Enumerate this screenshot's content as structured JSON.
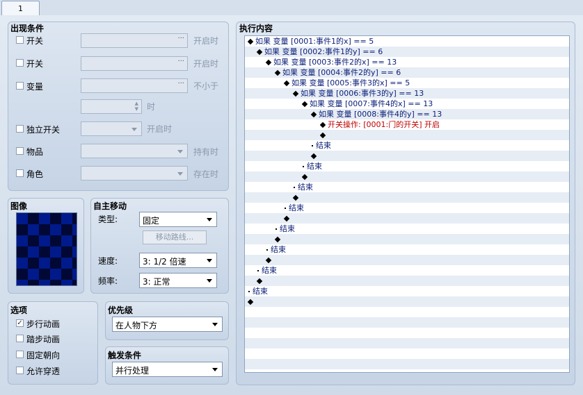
{
  "tab": {
    "label": "1"
  },
  "conditions": {
    "title": "出现条件",
    "rows": [
      {
        "label": "开关",
        "hint": "开启时"
      },
      {
        "label": "开关",
        "hint": "开启时"
      },
      {
        "label": "变量",
        "hint": "不小于"
      },
      {
        "label": "",
        "hint": "时"
      },
      {
        "label": "独立开关",
        "hint": "开启时"
      },
      {
        "label": "物品",
        "hint": "持有时"
      },
      {
        "label": "角色",
        "hint": "存在时"
      }
    ]
  },
  "image": {
    "title": "图像"
  },
  "movement": {
    "title": "自主移动",
    "type_label": "类型:",
    "type_value": "固定",
    "route_button": "移动路线...",
    "speed_label": "速度:",
    "speed_value": "3: 1/2 倍速",
    "freq_label": "频率:",
    "freq_value": "3: 正常"
  },
  "options": {
    "title": "选项",
    "items": [
      {
        "label": "步行动画",
        "checked": true
      },
      {
        "label": "踏步动画",
        "checked": false
      },
      {
        "label": "固定朝向",
        "checked": false
      },
      {
        "label": "允许穿透",
        "checked": false
      }
    ]
  },
  "priority": {
    "title": "优先级",
    "value": "在人物下方"
  },
  "trigger": {
    "title": "触发条件",
    "value": "并行处理"
  },
  "commands": {
    "title": "执行内容",
    "lines": [
      {
        "indent": 0,
        "marker": "diamond",
        "text": "如果 变量 [0001:事件1的x] == 5",
        "color": "normal"
      },
      {
        "indent": 1,
        "marker": "diamond",
        "text": "如果 变量 [0002:事件1的y] == 6",
        "color": "normal"
      },
      {
        "indent": 2,
        "marker": "diamond",
        "text": "如果 变量 [0003:事件2的x] == 13",
        "color": "normal"
      },
      {
        "indent": 3,
        "marker": "diamond",
        "text": "如果 变量 [0004:事件2的y] == 6",
        "color": "normal"
      },
      {
        "indent": 4,
        "marker": "diamond",
        "text": "如果 变量 [0005:事件3的x] == 5",
        "color": "normal"
      },
      {
        "indent": 5,
        "marker": "diamond",
        "text": "如果 变量 [0006:事件3的y] == 13",
        "color": "normal"
      },
      {
        "indent": 6,
        "marker": "diamond",
        "text": "如果 变量 [0007:事件4的x] == 13",
        "color": "normal"
      },
      {
        "indent": 7,
        "marker": "diamond",
        "text": "如果 变量 [0008:事件4的y] == 13",
        "color": "normal"
      },
      {
        "indent": 8,
        "marker": "diamond",
        "text": "开关操作: [0001:门的开关] 开启",
        "color": "red"
      },
      {
        "indent": 8,
        "marker": "diamond",
        "text": "",
        "color": "normal"
      },
      {
        "indent": 7,
        "marker": "dot",
        "text": "结束",
        "color": "normal"
      },
      {
        "indent": 7,
        "marker": "diamond",
        "text": "",
        "color": "normal"
      },
      {
        "indent": 6,
        "marker": "dot",
        "text": "结束",
        "color": "normal"
      },
      {
        "indent": 6,
        "marker": "diamond",
        "text": "",
        "color": "normal"
      },
      {
        "indent": 5,
        "marker": "dot",
        "text": "结束",
        "color": "normal"
      },
      {
        "indent": 5,
        "marker": "diamond",
        "text": "",
        "color": "normal"
      },
      {
        "indent": 4,
        "marker": "dot",
        "text": "结束",
        "color": "normal"
      },
      {
        "indent": 4,
        "marker": "diamond",
        "text": "",
        "color": "normal"
      },
      {
        "indent": 3,
        "marker": "dot",
        "text": "结束",
        "color": "normal"
      },
      {
        "indent": 3,
        "marker": "diamond",
        "text": "",
        "color": "normal"
      },
      {
        "indent": 2,
        "marker": "dot",
        "text": "结束",
        "color": "normal"
      },
      {
        "indent": 2,
        "marker": "diamond",
        "text": "",
        "color": "normal"
      },
      {
        "indent": 1,
        "marker": "dot",
        "text": "结束",
        "color": "normal"
      },
      {
        "indent": 1,
        "marker": "diamond",
        "text": "",
        "color": "normal"
      },
      {
        "indent": 0,
        "marker": "dot",
        "text": "结束",
        "color": "normal"
      },
      {
        "indent": 0,
        "marker": "diamond",
        "text": "",
        "color": "normal"
      }
    ]
  }
}
